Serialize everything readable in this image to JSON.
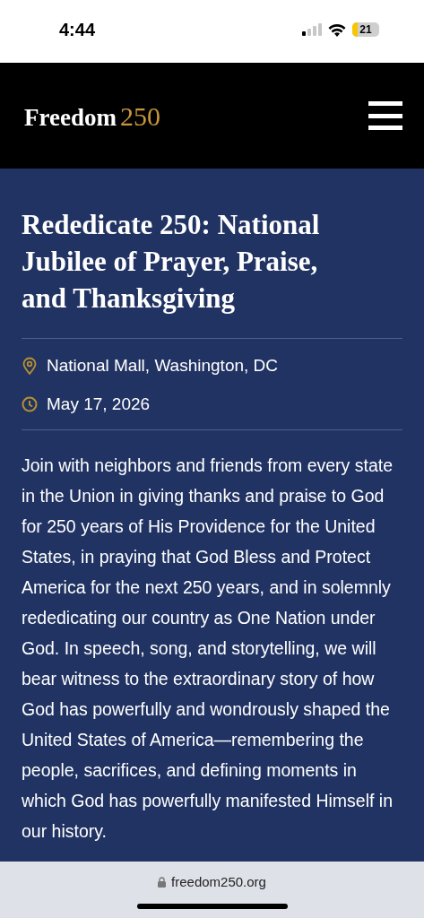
{
  "status_bar": {
    "time": "4:44",
    "battery": "21"
  },
  "header": {
    "logo_word": "Freedom",
    "logo_number": "250"
  },
  "event": {
    "title": "Rededicate 250: National Jubilee of Prayer, Praise, and Thanksgiving",
    "details": [
      {
        "kind": "location",
        "text": "National Mall, Washington, DC"
      },
      {
        "kind": "date",
        "text": "May 17, 2026"
      }
    ],
    "paragraphs": [
      "Join with neighbors and friends from every state in the Union in giving thanks and praise to God for 250 years of His Providence for the United States, in praying that God Bless and Protect America for the next 250 years, and in solemnly rededicating our country as One Nation under God. In speech, song, and storytelling, we will bear witness to the extraordinary story of how God has powerfully and wondrously shaped the United States of America—remembering the people, sacrifices, and defining moments in which God has powerfully manifested Himself in our history."
    ]
  },
  "browser_bar": {
    "url": "freedom250.org"
  }
}
